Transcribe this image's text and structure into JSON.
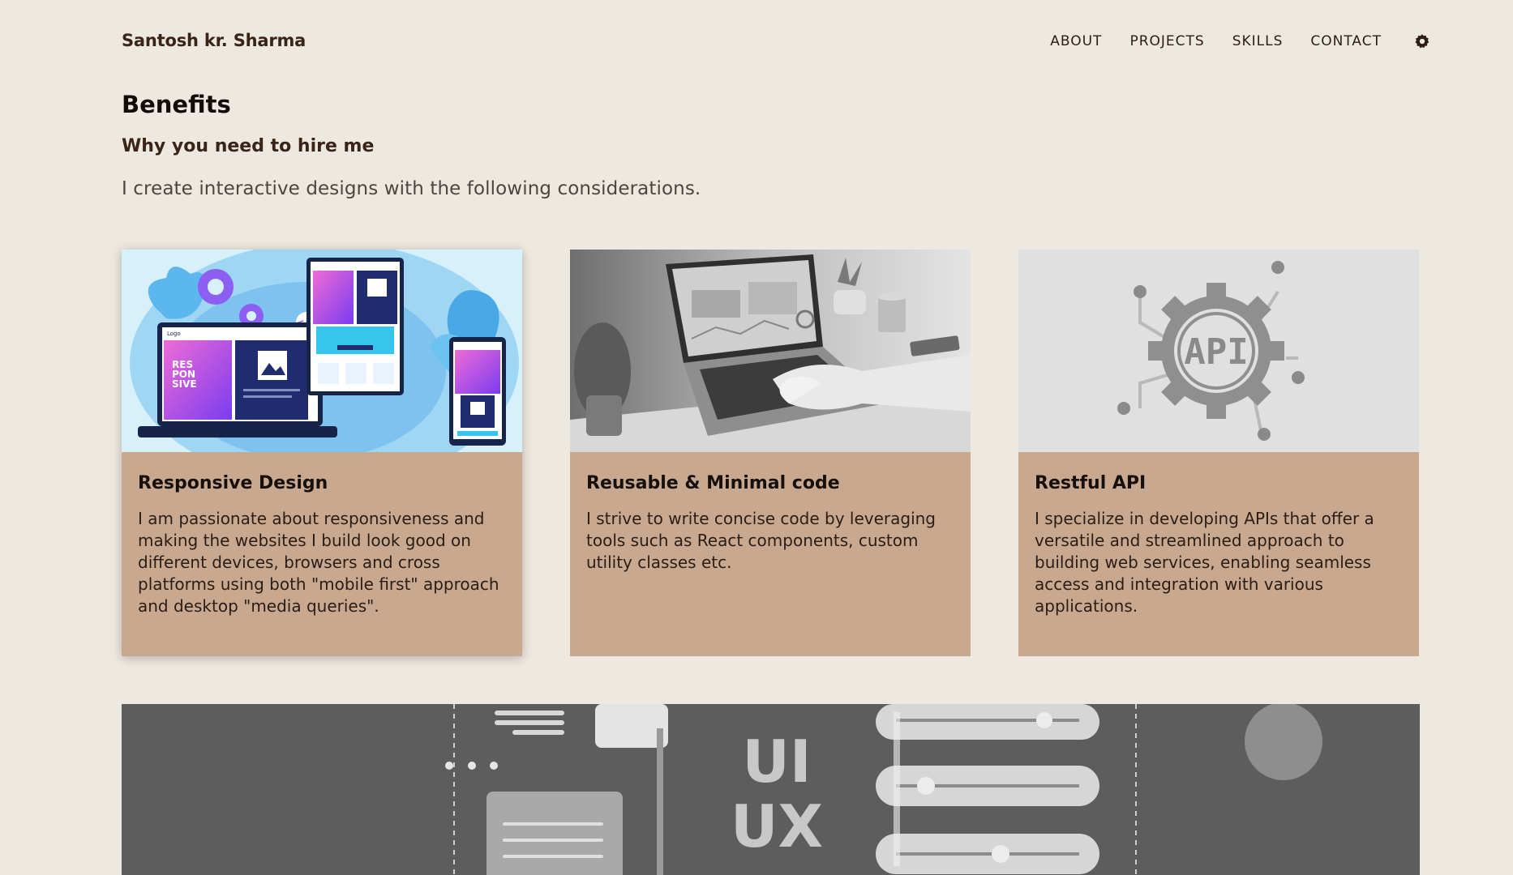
{
  "header": {
    "brand": "Santosh kr. Sharma",
    "nav": [
      "ABOUT",
      "PROJECTS",
      "SKILLS",
      "CONTACT"
    ],
    "theme_icon": "gear-icon"
  },
  "intro": {
    "title": "Benefits",
    "subtitle": "Why you need to hire me",
    "text": "I create interactive designs with the following considerations."
  },
  "cards": [
    {
      "title": "Responsive Design",
      "text": "I am passionate about responsiveness and making the websites I build look good on different devices, browsers and cross platforms using both \"mobile first\" approach and desktop \"media queries\".",
      "image": "responsive-design-illustration"
    },
    {
      "title": "Reusable & Minimal code",
      "text": "I strive to write concise code by leveraging tools such as React components, custom utility classes etc.",
      "image": "laptop-typing-photo"
    },
    {
      "title": "Restful API",
      "text": "I specialize in developing APIs that offer a versatile and streamlined approach to building web services, enabling seamless access and integration with various applications.",
      "image": "api-gear-illustration"
    }
  ],
  "illustrations": {
    "card1": {
      "screen_heading": "RES PON SIVE WEBSITE DESIGN",
      "logo": "Logo",
      "code_badge": "</>"
    },
    "card3": {
      "badge": "API"
    },
    "banner": {
      "ui": "UI",
      "ux": "UX"
    }
  },
  "colors": {
    "background": "#ede8e0",
    "card": "#c8a990",
    "brand": "#3a2418",
    "banner": "#5c5c5c"
  }
}
